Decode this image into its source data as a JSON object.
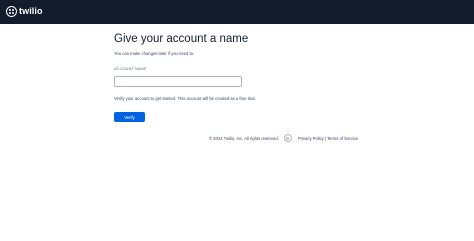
{
  "header": {
    "logo_text": "twilio"
  },
  "main": {
    "title": "Give your account a name",
    "subtitle": "You can make changes later if you need to.",
    "account_name_label": "ACCOUNT NAME",
    "account_name_value": "",
    "account_name_placeholder": "",
    "verify_note": "Verify your account to get started. This account will be created as a free trial.",
    "verify_button_label": "Verify"
  },
  "footer": {
    "copyright": "© 2024 Twilio, Inc. All rights reserved.",
    "badge_icon": "accessibility-badge-icon",
    "privacy_link": "Privacy Policy",
    "separator": "|",
    "terms_link": "Terms of Service"
  },
  "colors": {
    "header_bg": "#121c2d",
    "primary_button": "#0263e0",
    "text": "#121c2d"
  }
}
